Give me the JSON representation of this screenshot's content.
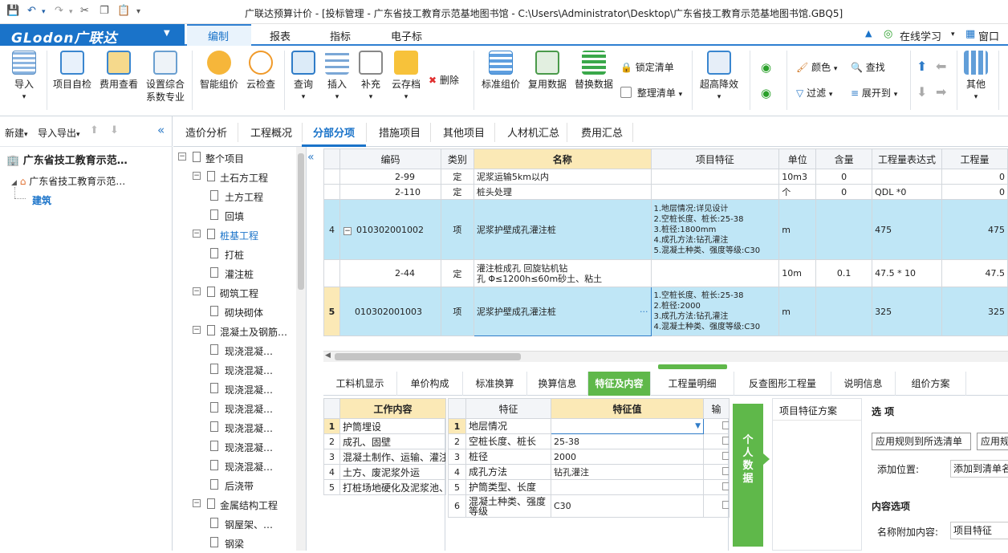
{
  "titlebar": {
    "title": "广联达预算计价 - [投标管理 - 广东省技工教育示范基地图书馆 - C:\\Users\\Administrator\\Desktop\\广东省技工教育示范基地图书馆.GBQ5]"
  },
  "menubar": {
    "brand": "GLodon广联达",
    "tabs": [
      "编制",
      "报表",
      "指标",
      "电子标"
    ],
    "online_learning": "在线学习",
    "window": "窗口"
  },
  "ribbon": {
    "buttons": [
      {
        "label": "导入",
        "icon": "import-icon"
      },
      {
        "label": "项目自检",
        "icon": "self-check-icon"
      },
      {
        "label": "费用查看",
        "icon": "cost-view-icon"
      },
      {
        "label": "设置综合",
        "label2": "系数专业",
        "icon": "settings-coefficient-icon"
      },
      {
        "label": "智能组价",
        "icon": "smart-pricing-icon"
      },
      {
        "label": "云检查",
        "icon": "cloud-check-icon"
      },
      {
        "label": "查询",
        "icon": "query-icon"
      },
      {
        "label": "插入",
        "icon": "insert-icon"
      },
      {
        "label": "补充",
        "icon": "supplement-icon"
      },
      {
        "label": "云存档",
        "icon": "cloud-archive-icon"
      },
      {
        "label": "标准组价",
        "icon": "standard-pricing-icon"
      },
      {
        "label": "复用数据",
        "icon": "reuse-data-icon"
      },
      {
        "label": "替换数据",
        "icon": "replace-data-icon"
      },
      {
        "label": "超高降效",
        "icon": "high-efficiency-icon"
      },
      {
        "label": "其他",
        "icon": "other-icon"
      }
    ],
    "delete": "删除",
    "lock_list": "锁定清单",
    "organize_list": "整理清单",
    "color": "颜色",
    "filter": "过滤",
    "find": "查找",
    "expand_to": "展开到"
  },
  "left": {
    "new": "新建",
    "import_export": "导入导出",
    "project": "广东省技工教育示范…",
    "sub_project": "广东省技工教育示范…",
    "building": "建筑"
  },
  "doctabs": [
    "造价分析",
    "工程概况",
    "分部分项",
    "措施项目",
    "其他项目",
    "人材机汇总",
    "费用汇总"
  ],
  "subtree": [
    {
      "label": "整个项目",
      "level": 0,
      "type": "group"
    },
    {
      "label": "土石方工程",
      "level": 1,
      "type": "group"
    },
    {
      "label": "土方工程",
      "level": 2,
      "type": "doc"
    },
    {
      "label": "回填",
      "level": 2,
      "type": "doc"
    },
    {
      "label": "桩基工程",
      "level": 1,
      "type": "group",
      "active": true
    },
    {
      "label": "打桩",
      "level": 2,
      "type": "doc"
    },
    {
      "label": "灌注桩",
      "level": 2,
      "type": "doc"
    },
    {
      "label": "砌筑工程",
      "level": 1,
      "type": "group"
    },
    {
      "label": "砌块砌体",
      "level": 2,
      "type": "doc"
    },
    {
      "label": "混凝土及钢筋…",
      "level": 1,
      "type": "group"
    },
    {
      "label": "现浇混凝…",
      "level": 2,
      "type": "doc"
    },
    {
      "label": "现浇混凝…",
      "level": 2,
      "type": "doc"
    },
    {
      "label": "现浇混凝…",
      "level": 2,
      "type": "doc"
    },
    {
      "label": "现浇混凝…",
      "level": 2,
      "type": "doc"
    },
    {
      "label": "现浇混凝…",
      "level": 2,
      "type": "doc"
    },
    {
      "label": "现浇混凝…",
      "level": 2,
      "type": "doc"
    },
    {
      "label": "现浇混凝…",
      "level": 2,
      "type": "doc"
    },
    {
      "label": "后浇带",
      "level": 2,
      "type": "doc"
    },
    {
      "label": "金属结构工程",
      "level": 1,
      "type": "group"
    },
    {
      "label": "钢屋架、…",
      "level": 2,
      "type": "doc"
    },
    {
      "label": "钢梁",
      "level": 2,
      "type": "doc"
    }
  ],
  "grid": {
    "headers": [
      "编码",
      "类别",
      "名称",
      "项目特征",
      "单位",
      "含量",
      "工程量表达式",
      "工程量"
    ],
    "rows": [
      {
        "no": "",
        "code": "2-99",
        "cat": "定",
        "name": "泥浆运输5km以内",
        "feature": "",
        "unit": "10m3",
        "content": "0",
        "expr": "",
        "qty": "0"
      },
      {
        "no": "",
        "code": "2-110",
        "cat": "定",
        "name": "桩头处理",
        "feature": "",
        "unit": "个",
        "content": "0",
        "expr": "QDL *0",
        "qty": "0"
      },
      {
        "no": "4",
        "code": "010302001002",
        "cat": "项",
        "name": "泥浆护壁成孔灌注桩",
        "feature": "1.地层情况:详见设计\n2.空桩长度、桩长:25-38\n3.桩径:1800mm\n4.成孔方法:钻孔灌注\n5.混凝土种类、强度等级:C30",
        "unit": "m",
        "content": "",
        "expr": "475",
        "qty": "475"
      },
      {
        "no": "",
        "code": "2-44",
        "cat": "定",
        "name": "灌注桩成孔 回旋钻机钻\n孔 Φ≤1200h≤60m砂土、粘土",
        "feature": "",
        "unit": "10m",
        "content": "0.1",
        "expr": "47.5 * 10",
        "qty": "47.5"
      },
      {
        "no": "5",
        "code": "010302001003",
        "cat": "项",
        "name": "泥浆护壁成孔灌注桩",
        "feature": "1.空桩长度、桩长:25-38\n2.桩径:2000\n3.成孔方法:钻孔灌注\n4.混凝土种类、强度等级:C30",
        "unit": "m",
        "content": "",
        "expr": "325",
        "qty": "325"
      }
    ]
  },
  "bottom_tabs": [
    "工料机显示",
    "单价构成",
    "标准换算",
    "换算信息",
    "特征及内容",
    "工程量明细",
    "反查图形工程量",
    "说明信息",
    "组价方案"
  ],
  "work_content": {
    "header": "工作内容",
    "rows": [
      "护筒埋设",
      "成孔、固壁",
      "混凝土制作、运输、灌注",
      "土方、废泥浆外运",
      "打桩场地硬化及泥浆池、"
    ]
  },
  "features": {
    "headers": [
      "特征",
      "特征值",
      "输"
    ],
    "rows": [
      {
        "name": "地层情况",
        "value": ""
      },
      {
        "name": "空桩长度、桩长",
        "value": "25-38"
      },
      {
        "name": "桩径",
        "value": "2000"
      },
      {
        "name": "成孔方法",
        "value": "钻孔灌注"
      },
      {
        "name": "护筒类型、长度",
        "value": ""
      },
      {
        "name": "混凝土种类、强度\n等级",
        "value": "C30"
      }
    ]
  },
  "side_panel": {
    "personal_data": "个人数据",
    "scheme_title": "项目特征方案"
  },
  "options": {
    "title": "选 项",
    "apply_selected": "应用规则到所选清单",
    "apply_all": "应用规则",
    "add_position_label": "添加位置:",
    "add_position_value": "添加到清单名",
    "content_options": "内容选项",
    "name_append_label": "名称附加内容:",
    "name_append_value": "项目特征"
  },
  "colors": {
    "brand_blue": "#1a73c9",
    "active_green": "#5fb84a",
    "selected_row": "#bfe6f6",
    "header_yellow": "#fbe9b6"
  }
}
